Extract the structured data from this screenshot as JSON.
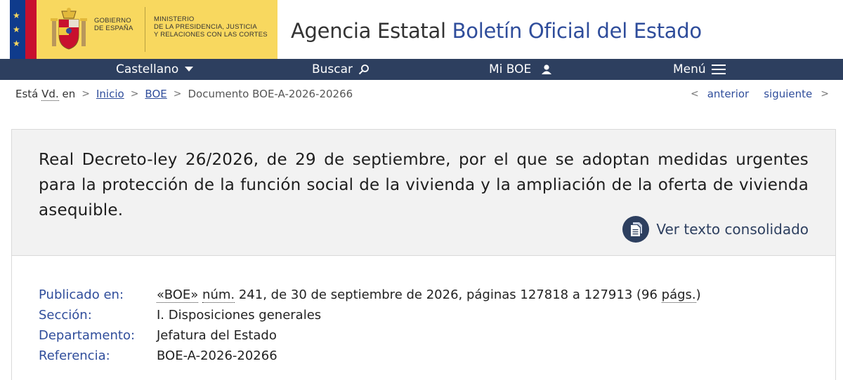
{
  "header": {
    "gov_line1": "GOBIERNO",
    "gov_line2": "DE ESPAÑA",
    "min_line1": "MINISTERIO",
    "min_line2": "DE LA PRESIDENCIA, JUSTICIA",
    "min_line3": "Y RELACIONES CON LAS CORTES",
    "title_main": "Agencia Estatal",
    "title_accent": "Boletín Oficial del Estado",
    "colors": {
      "flag_blue": "#0f3b8c",
      "gov_yellow": "#f8d85f",
      "accent": "#2f4d9b"
    }
  },
  "nav": {
    "language": "Castellano",
    "search": "Buscar",
    "my_boe": "Mi BOE",
    "menu": "Menú",
    "icons": [
      "caret-down-icon",
      "search-icon",
      "user-icon",
      "hamburger-icon"
    ],
    "color": "#2d3f5f"
  },
  "breadcrumb": {
    "prefix": "Está",
    "vd": "Vd.",
    "suffix": "en",
    "items": [
      "Inicio",
      "BOE"
    ],
    "current": "Documento BOE-A-2026-20266"
  },
  "pager": {
    "prev": "anterior",
    "next": "siguiente"
  },
  "document": {
    "title": "Real Decreto-ley 26/2026, de 29 de septiembre, por el que se adoptan medidas urgentes para la protección de la función social de la vivienda y la ampliación de la oferta de vivienda asequible.",
    "consolidated_label": "Ver texto consolidado",
    "meta": {
      "published_key": "Publicado en:",
      "published_boe": "«BOE»",
      "published_num_abbr": "núm.",
      "published_rest": "241, de 30 de septiembre de 2026, páginas 127818 a 127913 (96",
      "published_pags_abbr": "págs.",
      "published_close": ")",
      "section_key": "Sección:",
      "section_val": "I. Disposiciones generales",
      "department_key": "Departamento:",
      "department_val": "Jefatura del Estado",
      "reference_key": "Referencia:",
      "reference_val": "BOE-A-2026-20266"
    }
  }
}
